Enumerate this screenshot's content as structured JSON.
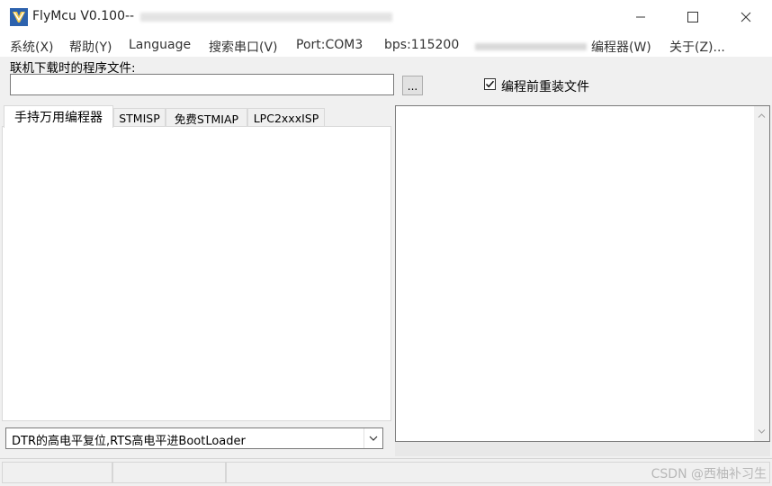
{
  "window": {
    "title": "FlyMcu V0.100--",
    "icons": [
      "app-logo-icon",
      "minimize-icon",
      "maximize-icon",
      "close-icon"
    ]
  },
  "menu": {
    "system": "系统(X)",
    "help": "帮助(Y)",
    "language": "Language",
    "search_port": "搜索串口(V)",
    "port": "Port:COM3",
    "bps": "bps:115200",
    "programmer": "编程器(W)",
    "about": "关于(Z)..."
  },
  "file": {
    "label": "联机下载时的程序文件:",
    "value": "",
    "browse_label": "...",
    "reload_checkbox_label": "编程前重装文件",
    "reload_checked": true
  },
  "tabs": [
    {
      "label": "手持万用编程器",
      "active": true
    },
    {
      "label": "STMISP",
      "active": false
    },
    {
      "label": "免费STMIAP",
      "active": false
    },
    {
      "label": "LPC2xxxISP",
      "active": false
    }
  ],
  "reset_mode": {
    "selected": "DTR的高电平复位,RTS高电平进BootLoader"
  },
  "log": {
    "text": ""
  },
  "watermark": "CSDN @西柚补习生"
}
